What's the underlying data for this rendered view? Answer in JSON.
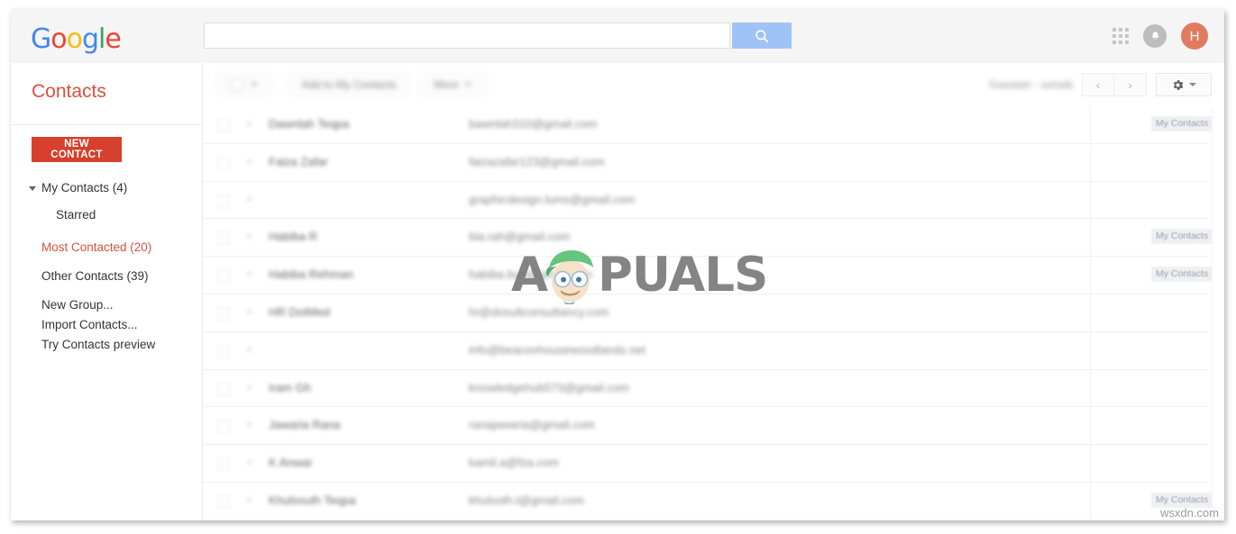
{
  "browser": {
    "watermark_center": "APPUALS",
    "watermark_corner": "wsxdn.com"
  },
  "topbar": {
    "brand": "Google",
    "brand_letters": [
      "G",
      "o",
      "o",
      "g",
      "l",
      "e"
    ],
    "search": {
      "value": "",
      "placeholder": "",
      "button_icon": "search-icon"
    },
    "apps_icon": "apps-grid-icon",
    "notifications_icon": "bell-icon",
    "avatar_initial": "H"
  },
  "sidebar": {
    "app_title": "Contacts",
    "new_contact_label": "NEW CONTACT",
    "items": [
      {
        "label": "My Contacts (4)",
        "type": "group",
        "expanded": true,
        "active": false
      },
      {
        "label": "Starred",
        "type": "child",
        "active": false
      },
      {
        "label": "Most Contacted (20)",
        "type": "group",
        "active": true
      },
      {
        "label": "Other Contacts (39)",
        "type": "group",
        "active": false
      },
      {
        "label": "New Group...",
        "type": "action",
        "active": false
      },
      {
        "label": "Import Contacts...",
        "type": "action",
        "active": false
      },
      {
        "label": "Try Contacts preview",
        "type": "action",
        "active": false
      }
    ]
  },
  "toolbar": {
    "select_all_label": "",
    "add_to_my_contacts_label": "Add to My Contacts",
    "more_label": "More",
    "page_range": "Dawalah - ashaib",
    "prev_label": "‹",
    "next_label": "›",
    "settings_icon": "gear-icon"
  },
  "contacts": {
    "badge_label": "My Contacts",
    "rows": [
      {
        "name": "Dawnlah Teqpa",
        "email": "bawnlah310@gmail.com",
        "badge": true
      },
      {
        "name": "Faiza Zafar",
        "email": "faizazafar123@gmail.com",
        "badge": false
      },
      {
        "name": "",
        "email": "graphicdesign.lums@gmail.com",
        "badge": false
      },
      {
        "name": "Habiba R",
        "email": "bia.rah@gmail.com",
        "badge": true
      },
      {
        "name": "Habiba Rehman",
        "email": "habiba.butt@gmail.com",
        "badge": true
      },
      {
        "name": "HR DotMed",
        "email": "hr@dosultconsultancy.com",
        "badge": false
      },
      {
        "name": "",
        "email": "info@beaconhousewoodlands.net",
        "badge": false
      },
      {
        "name": "Iram Gh",
        "email": "knowledgehub573@gmail.com",
        "badge": false
      },
      {
        "name": "Jawaria Rana",
        "email": "ranajawaria@gmail.com",
        "badge": false
      },
      {
        "name": "K Anwar",
        "email": "kamil.a@fza.com",
        "badge": false
      },
      {
        "name": "Khulsouth Teqpa",
        "email": "khulsoth.t@gmail.com",
        "badge": true
      }
    ]
  },
  "colors": {
    "brand_red": "#d6402c",
    "title_red": "#d9503f",
    "search_button": "#a0c3f5",
    "avatar": "#e07b60",
    "topbar_bg": "#f5f5f5"
  }
}
